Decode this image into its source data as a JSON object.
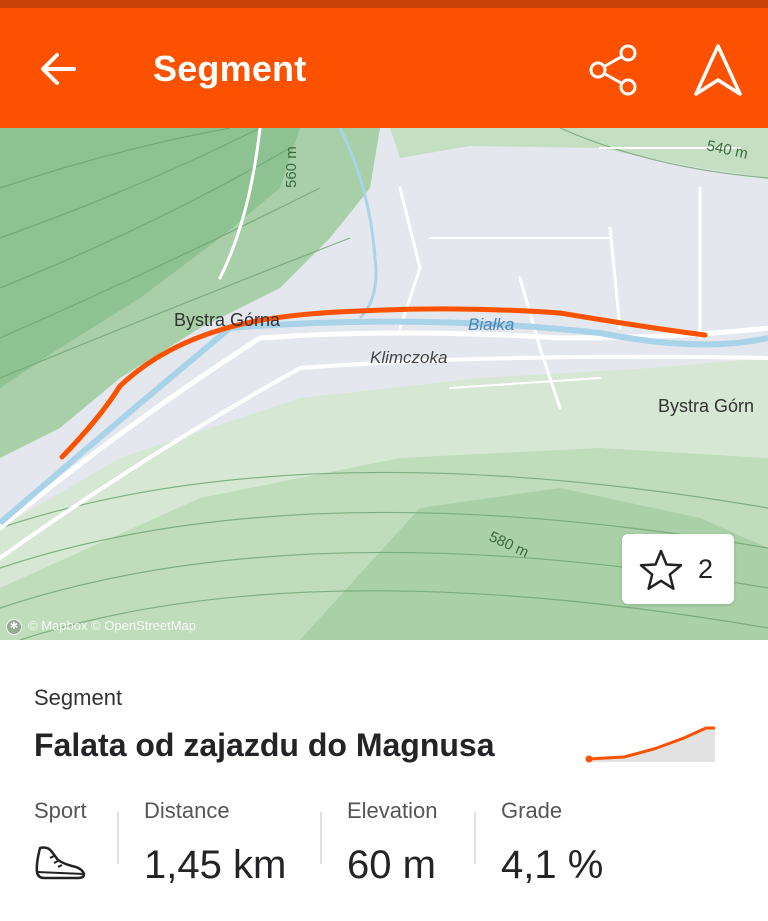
{
  "app_bar": {
    "title": "Segment",
    "back_icon": "arrow-left-icon",
    "share_icon": "share-icon",
    "navigate_icon": "navigate-arrow-icon"
  },
  "map": {
    "labels": {
      "contour_560": "560 m",
      "contour_540": "540 m",
      "contour_580": "580 m",
      "place_west": "Bystra Górna",
      "river": "Białka",
      "street": "Klimczoka",
      "place_east": "Bystra Górn"
    },
    "attribution": "© Mapbox © OpenStreetMap",
    "route_color": "#fc5200"
  },
  "star": {
    "count": "2",
    "icon": "star-outline-icon"
  },
  "segment": {
    "type_label": "Segment",
    "name": "Falata od zajazdu do Magnusa"
  },
  "stats": {
    "sport": {
      "label": "Sport",
      "icon": "running-shoe-icon"
    },
    "distance": {
      "label": "Distance",
      "value": "1,45 km"
    },
    "elevation": {
      "label": "Elevation",
      "value": "60 m"
    },
    "grade": {
      "label": "Grade",
      "value": "4,1 %"
    }
  },
  "colors": {
    "brand": "#fc5200",
    "status_bar": "#c94407"
  }
}
